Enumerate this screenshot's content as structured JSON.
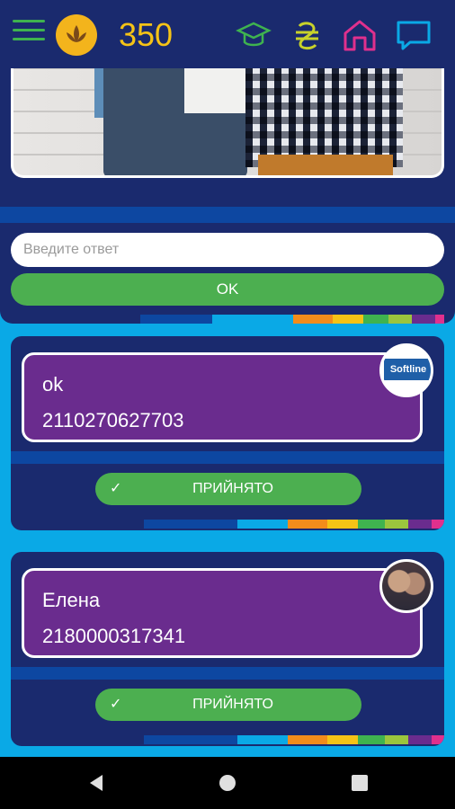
{
  "topbar": {
    "points": "350",
    "icons": {
      "menu": "menu-icon",
      "coin": "lotus-coin-icon",
      "graduation": "graduation-cap-icon",
      "currency": "hryvnia-icon",
      "home": "home-icon",
      "chat": "chat-icon"
    },
    "colors": {
      "menu": "#3fb34f",
      "points": "#f5c316",
      "graduation": "#3fb34f",
      "currency": "#c8d22a",
      "home": "#e0308d",
      "chat": "#0aa9e6"
    }
  },
  "answer_form": {
    "placeholder": "Введите ответ",
    "submit_label": "OK"
  },
  "answers": [
    {
      "name": "ok",
      "code": "2110270627703",
      "status": "ПРИЙНЯТО",
      "avatar": "Softline"
    },
    {
      "name": "Елена",
      "code": "2180000317341",
      "status": "ПРИЙНЯТО",
      "avatar": "user-photo"
    }
  ],
  "colorbar": [
    "#0d47a1",
    "#0aa9e6",
    "#f28c1b",
    "#f5c316",
    "#3fb34f",
    "#9bc53d",
    "#6a2c8e",
    "#e0308d"
  ],
  "navbar": {
    "icons": [
      "back-icon",
      "home-circle-icon",
      "recents-icon"
    ]
  }
}
